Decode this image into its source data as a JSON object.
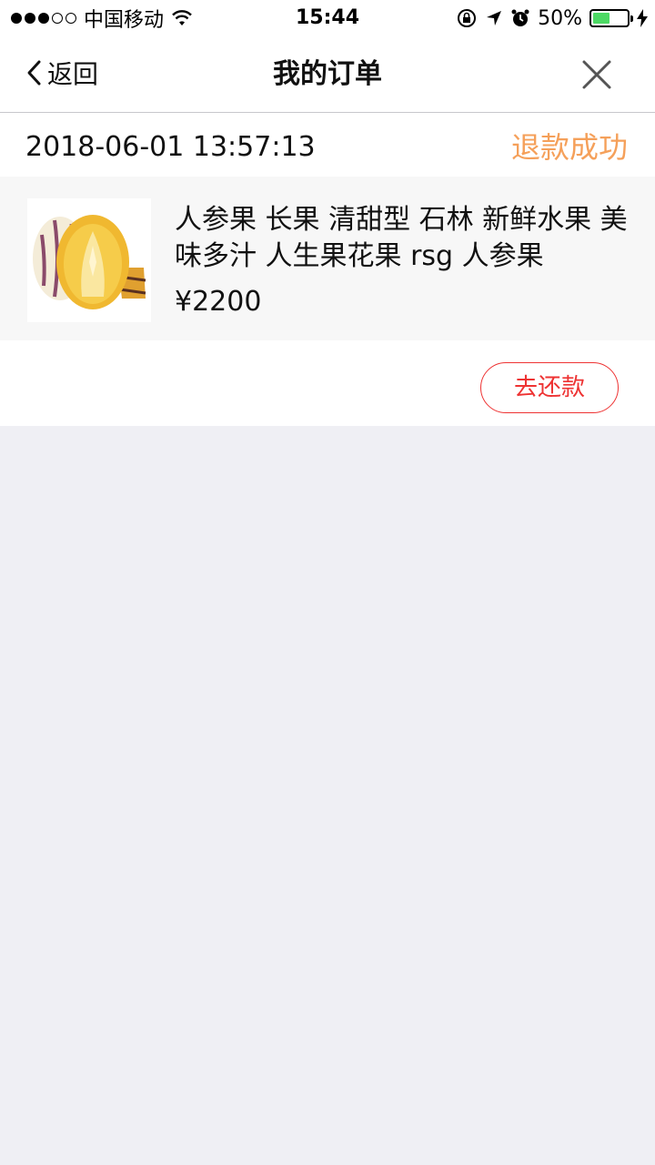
{
  "status_bar": {
    "carrier": "中国移动",
    "time": "15:44",
    "battery_percent": "50%",
    "battery_level": 0.5,
    "icons": [
      "signal-dots-icon",
      "wifi-icon",
      "orientation-lock-icon",
      "location-icon",
      "alarm-icon",
      "battery-icon",
      "charging-icon"
    ]
  },
  "nav": {
    "back_label": "返回",
    "title": "我的订单",
    "icons": [
      "chevron-left-icon",
      "close-icon"
    ]
  },
  "order": {
    "datetime": "2018-06-01 13:57:13",
    "status": "退款成功",
    "status_color": "#f5a05a",
    "item": {
      "title": "人参果 长果 清甜型 石林 新鲜水果 美味多汁 人生果花果 rsg 人参果",
      "price": "¥2200",
      "image": "pepino-melon-image"
    },
    "action_label": "去还款",
    "action_color": "#e33333"
  }
}
